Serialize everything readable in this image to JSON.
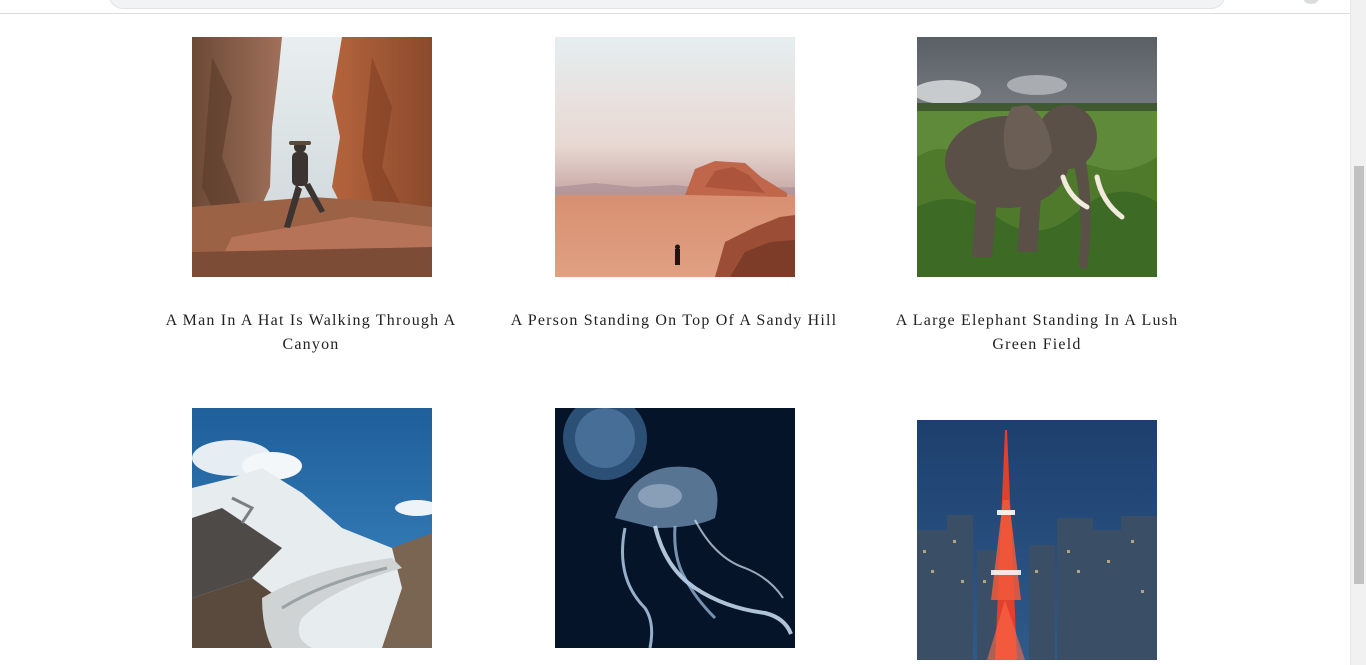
{
  "gallery": {
    "items": [
      {
        "caption": "A Man In A Hat Is Walking Through A Canyon",
        "image": "canyon-hiker-photo"
      },
      {
        "caption": "A Person Standing On Top Of A Sandy Hill",
        "image": "desert-rock-photo"
      },
      {
        "caption": "A Large Elephant Standing In A Lush Green Field",
        "image": "elephant-photo"
      },
      {
        "caption": "",
        "image": "snowy-mountain-glacier-photo"
      },
      {
        "caption": "",
        "image": "jellyfish-photo"
      },
      {
        "caption": "",
        "image": "tokyo-tower-city-photo"
      }
    ]
  },
  "colors": {
    "caption_text": "#222222",
    "scroll_thumb": "#c1c1c1"
  }
}
